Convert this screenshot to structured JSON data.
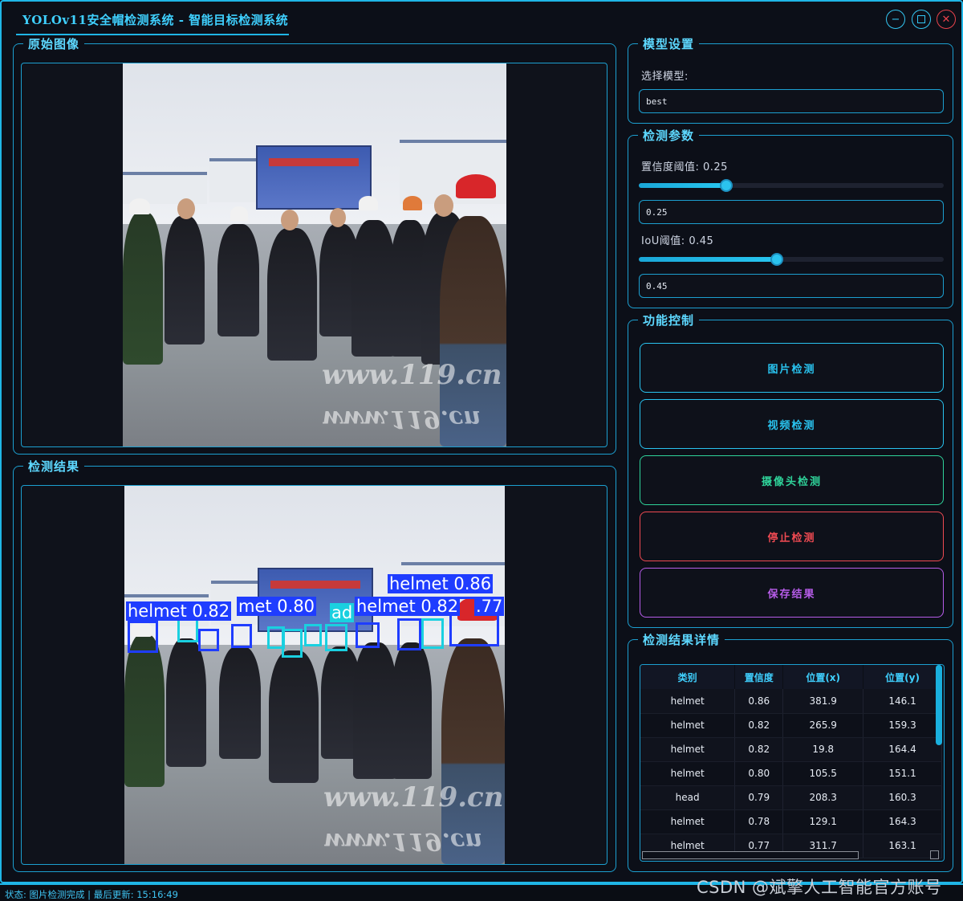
{
  "window": {
    "title": "YOLOv11安全帽检测系统 - 智能目标检测系统",
    "min_icon": "minimize-icon",
    "max_icon": "maximize-icon",
    "close_icon": "close-icon"
  },
  "panels": {
    "original_title": "原始图像",
    "result_title": "检测结果"
  },
  "watermark": {
    "top": "www.119.cn",
    "bottom": "www.119.cn"
  },
  "detections_overlay": [
    {
      "label": "helmet 0.86"
    },
    {
      "label": "helmet 0.82"
    },
    {
      "label": "met 0.80"
    },
    {
      "label": "helmet 0.82"
    },
    {
      "label": ".77"
    },
    {
      "label": "ad"
    }
  ],
  "model_settings": {
    "title": "模型设置",
    "select_label": "选择模型:",
    "selected_model": "best"
  },
  "detection_params": {
    "title": "检测参数",
    "conf_label": "置信度阈值: 0.25",
    "conf_value": "0.25",
    "conf_level": 0.25,
    "iou_label": "IoU阈值: 0.45",
    "iou_value": "0.45",
    "iou_level": 0.45
  },
  "controls": {
    "title": "功能控制",
    "buttons": [
      {
        "label": "图片检测",
        "color": "#29c3ef"
      },
      {
        "label": "视频检测",
        "color": "#29c3ef"
      },
      {
        "label": "摄像头检测",
        "color": "#2fd39a"
      },
      {
        "label": "停止检测",
        "color": "#ef4a52"
      },
      {
        "label": "保存结果",
        "color": "#b65ce8"
      }
    ]
  },
  "results": {
    "title": "检测结果详情",
    "headers": [
      "类别",
      "置信度",
      "位置(x)",
      "位置(y)"
    ],
    "rows": [
      [
        "helmet",
        "0.86",
        "381.9",
        "146.1"
      ],
      [
        "helmet",
        "0.82",
        "265.9",
        "159.3"
      ],
      [
        "helmet",
        "0.82",
        "19.8",
        "164.4"
      ],
      [
        "helmet",
        "0.80",
        "105.5",
        "151.1"
      ],
      [
        "head",
        "0.79",
        "208.3",
        "160.3"
      ],
      [
        "helmet",
        "0.78",
        "129.1",
        "164.3"
      ],
      [
        "helmet",
        "0.77",
        "311.7",
        "163.1"
      ]
    ]
  },
  "status": {
    "text": "状态: 图片检测完成 | 最后更新: 15:16:49"
  },
  "csdn_watermark": "CSDN @斌擎人工智能官方账号",
  "colors": {
    "accent": "#1fb5e6",
    "title": "#3fd0ff",
    "bbox_blue": "#1f3dff",
    "bbox_cyan": "#1ad0e0"
  }
}
